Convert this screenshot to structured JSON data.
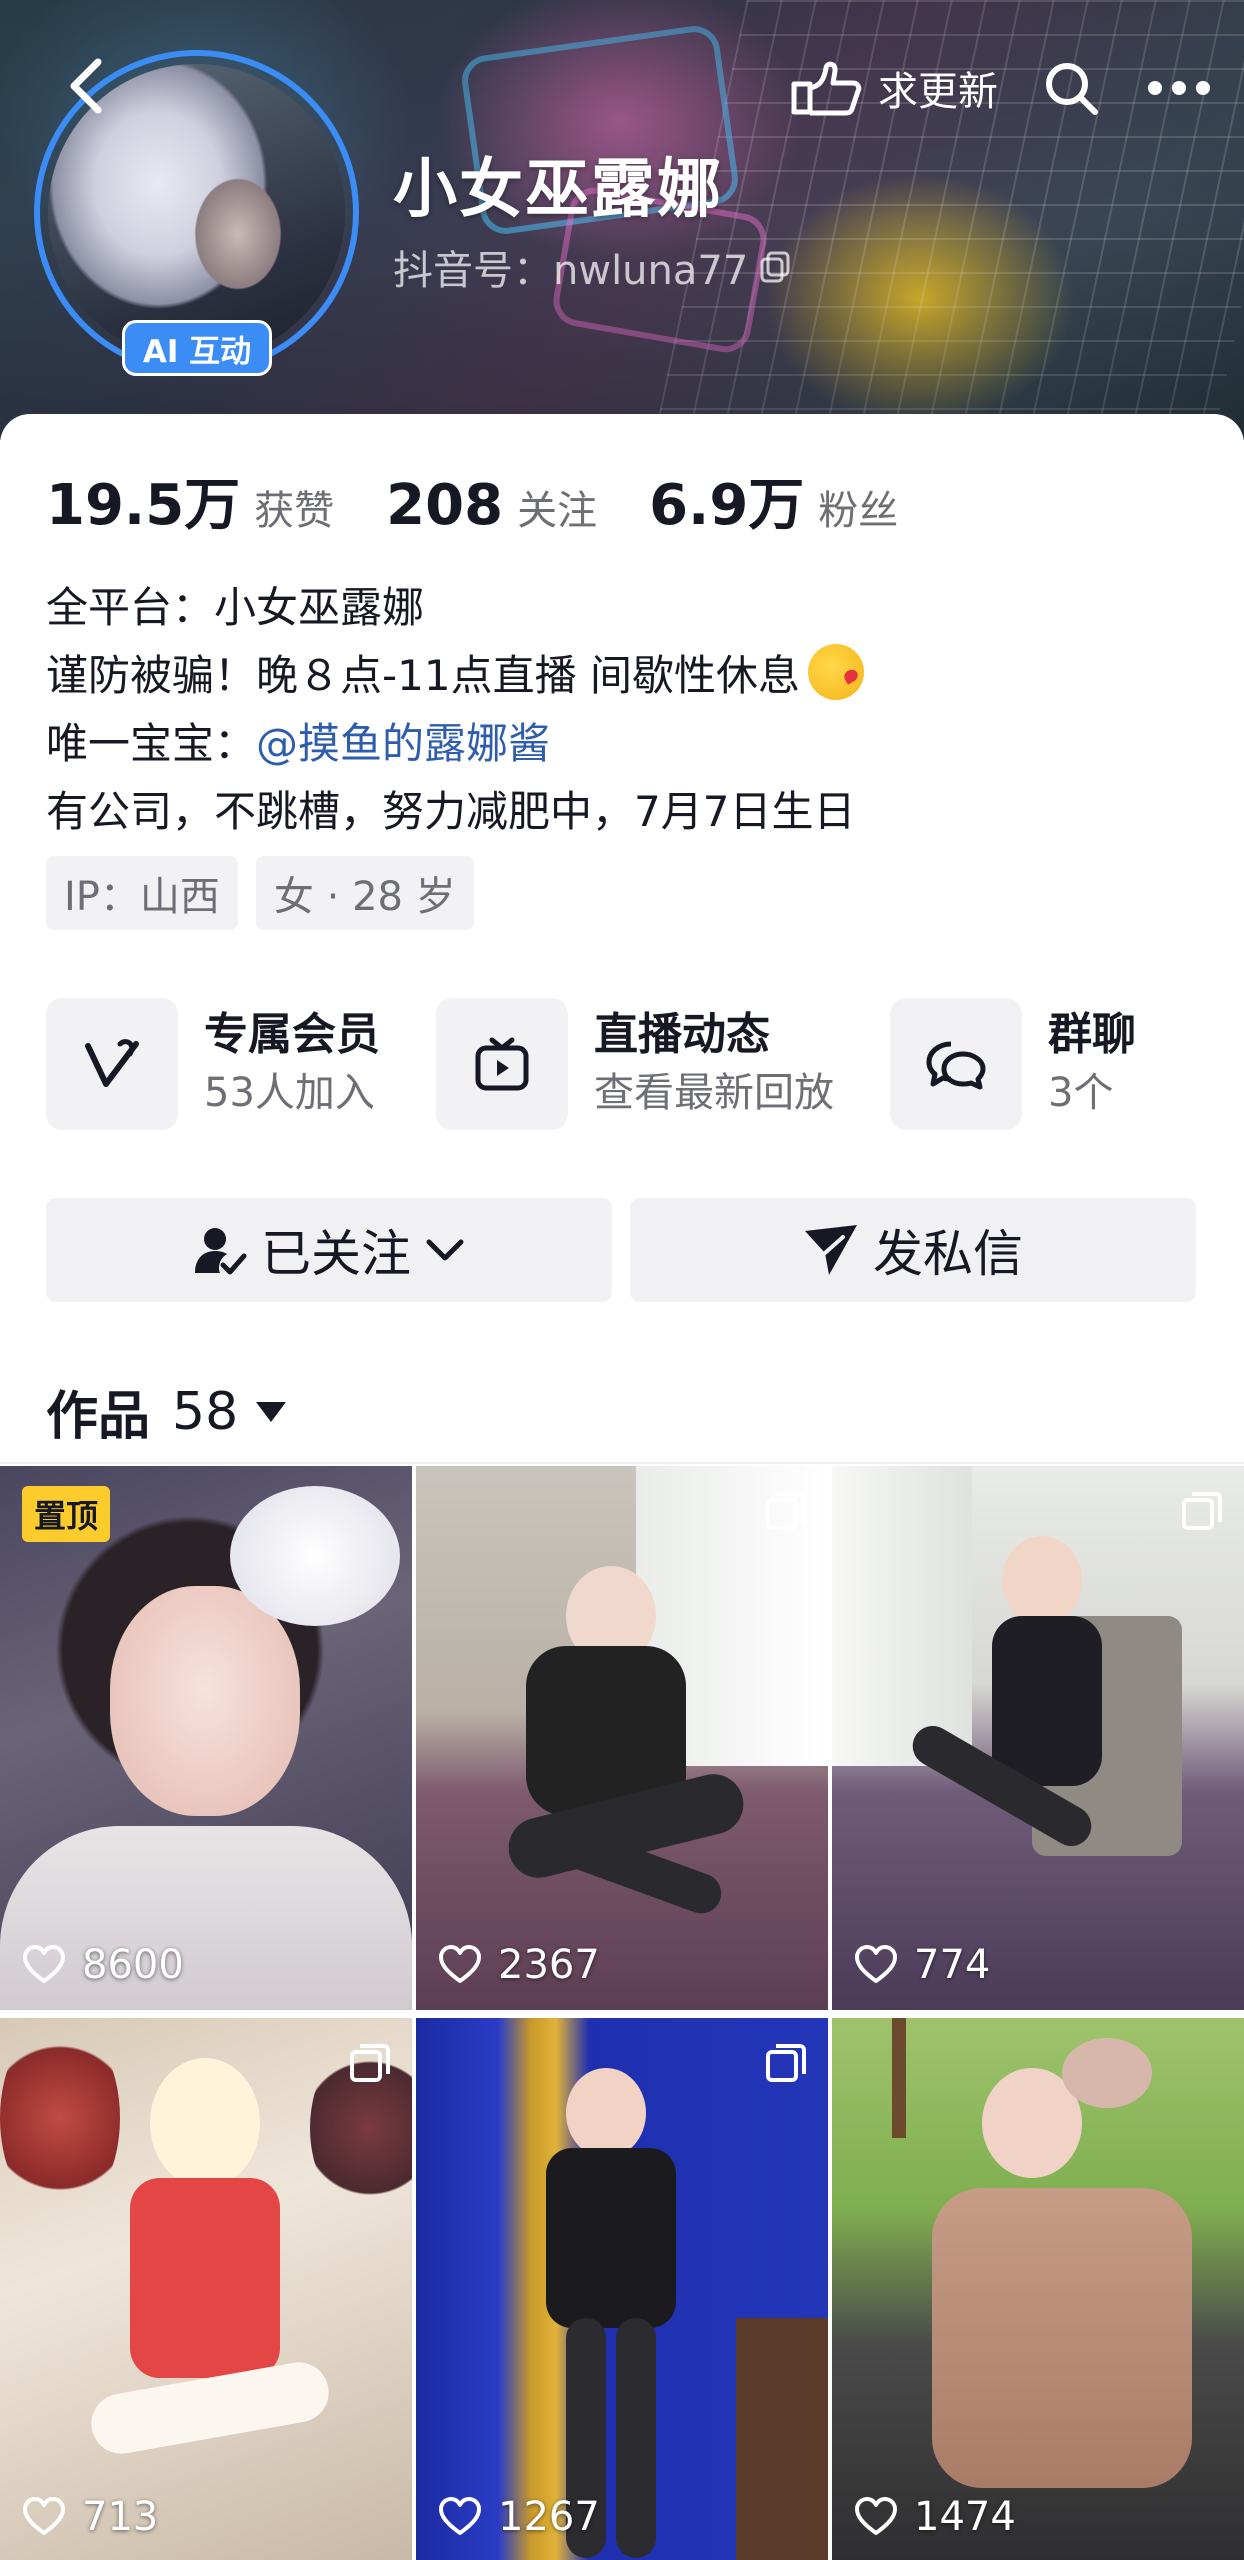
{
  "header": {
    "request_update_label": "求更新",
    "ai_badge": "AI 互动",
    "name": "小女巫露娜",
    "douyin_id": "抖音号：nwluna77"
  },
  "stats": [
    {
      "value": "19.5万",
      "label": "获赞"
    },
    {
      "value": "208",
      "label": "关注"
    },
    {
      "value": "6.9万",
      "label": "粉丝"
    }
  ],
  "bio": {
    "line1": "全平台：小女巫露娜",
    "line2": "谨防被骗！晚８点-11点直播 间歇性休息",
    "line3_prefix": "唯一宝宝：",
    "line3_mention": "@摸鱼的露娜酱",
    "line4": "有公司，不跳槽，努力减肥中，7月7日生日"
  },
  "tags": [
    "IP：山西",
    "女 · 28 岁"
  ],
  "features": [
    {
      "title": "专属会员",
      "subtitle": "53人加入",
      "icon": "v-heart-icon"
    },
    {
      "title": "直播动态",
      "subtitle": "查看最新回放",
      "icon": "tv-play-icon"
    },
    {
      "title": "群聊",
      "subtitle": "3个",
      "icon": "chat-bubbles-icon"
    }
  ],
  "actions": {
    "follow_label": "已关注",
    "message_label": "发私信"
  },
  "works": {
    "label": "作品",
    "count": "58"
  },
  "posts": [
    {
      "likes": "8600",
      "pinned_label": "置顶"
    },
    {
      "likes": "2367"
    },
    {
      "likes": "774"
    },
    {
      "likes": "713"
    },
    {
      "likes": "1267"
    },
    {
      "likes": "1474"
    }
  ],
  "colors": {
    "accent_blue": "#3b8df5",
    "mention_blue": "#2f5dad",
    "pin_yellow": "#fccb2c",
    "text_primary": "#161823",
    "text_secondary": "#6e6f76"
  }
}
